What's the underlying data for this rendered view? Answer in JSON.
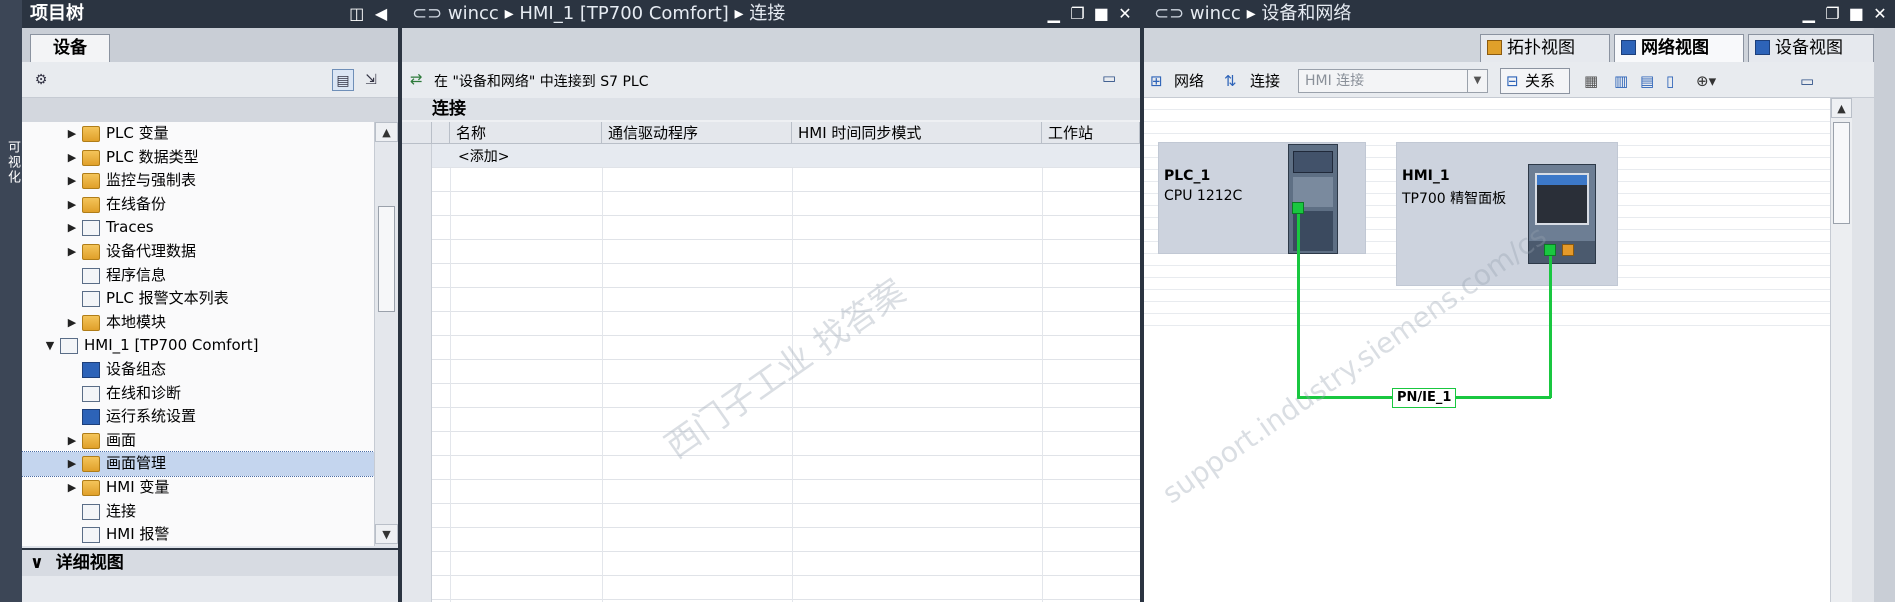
{
  "left_strip": {
    "label": "可视化"
  },
  "tree_panel": {
    "title": "项目树",
    "tab": "设备",
    "items": [
      {
        "label": "PLC 变量",
        "icon": "plc-tag-table-icon",
        "indent": 1,
        "arrow": "▶"
      },
      {
        "label": "PLC 数据类型",
        "icon": "plc-datatype-icon",
        "indent": 1,
        "arrow": "▶"
      },
      {
        "label": "监控与强制表",
        "icon": "watch-table-icon",
        "indent": 1,
        "arrow": "▶"
      },
      {
        "label": "在线备份",
        "icon": "online-backup-icon",
        "indent": 1,
        "arrow": "▶"
      },
      {
        "label": "Traces",
        "icon": "traces-icon",
        "indent": 1,
        "arrow": "▶"
      },
      {
        "label": "设备代理数据",
        "icon": "device-proxy-icon",
        "indent": 1,
        "arrow": "▶"
      },
      {
        "label": "程序信息",
        "icon": "program-info-icon",
        "indent": 1,
        "arrow": ""
      },
      {
        "label": "PLC 报警文本列表",
        "icon": "alarm-text-list-icon",
        "indent": 1,
        "arrow": ""
      },
      {
        "label": "本地模块",
        "icon": "local-modules-icon",
        "indent": 1,
        "arrow": "▶"
      },
      {
        "label": "HMI_1 [TP700 Comfort]",
        "icon": "hmi-device-icon",
        "indent": 0,
        "arrow": "▼"
      },
      {
        "label": "设备组态",
        "icon": "device-config-icon",
        "indent": 1,
        "arrow": ""
      },
      {
        "label": "在线和诊断",
        "icon": "online-diagnostics-icon",
        "indent": 1,
        "arrow": ""
      },
      {
        "label": "运行系统设置",
        "icon": "runtime-settings-icon",
        "indent": 1,
        "arrow": ""
      },
      {
        "label": "画面",
        "icon": "screens-folder-icon",
        "indent": 1,
        "arrow": "▶"
      },
      {
        "label": "画面管理",
        "icon": "screen-management-icon",
        "indent": 1,
        "arrow": "▶",
        "selected": true
      },
      {
        "label": "HMI 变量",
        "icon": "hmi-tags-icon",
        "indent": 1,
        "arrow": "▶"
      },
      {
        "label": "连接",
        "icon": "connections-icon",
        "indent": 1,
        "arrow": ""
      },
      {
        "label": "HMI 报警",
        "icon": "hmi-alarms-icon",
        "indent": 1,
        "arrow": ""
      }
    ],
    "detail_view": "详细视图",
    "detail_arrow": "∨"
  },
  "mid_panel": {
    "breadcrumb": [
      "wincc",
      "HMI_1 [TP700 Comfort]",
      "连接"
    ],
    "toolbar_text": "在 \"设备和网络\" 中连接到 S7 PLC",
    "section": "连接",
    "columns": [
      "名称",
      "通信驱动程序",
      "HMI 时间同步模式",
      "工作站"
    ],
    "add_row": "<添加>"
  },
  "right_panel": {
    "breadcrumb": [
      "wincc",
      "设备和网络"
    ],
    "tabs": [
      "拓扑视图",
      "网络视图",
      "设备视图"
    ],
    "active_tab": "网络视图",
    "toolbar": {
      "network": "网络",
      "connections": "连接",
      "hmi_select": "HMI 连接",
      "relations": "关系"
    },
    "devices": [
      {
        "name": "PLC_1",
        "type": "CPU 1212C"
      },
      {
        "name": "HMI_1",
        "type": "TP700 精智面板"
      }
    ],
    "network_label": "PN/IE_1"
  },
  "colors": {
    "network_green": "#19c740",
    "selection": "#c4d5ee",
    "titlebar": "#2b3441"
  }
}
